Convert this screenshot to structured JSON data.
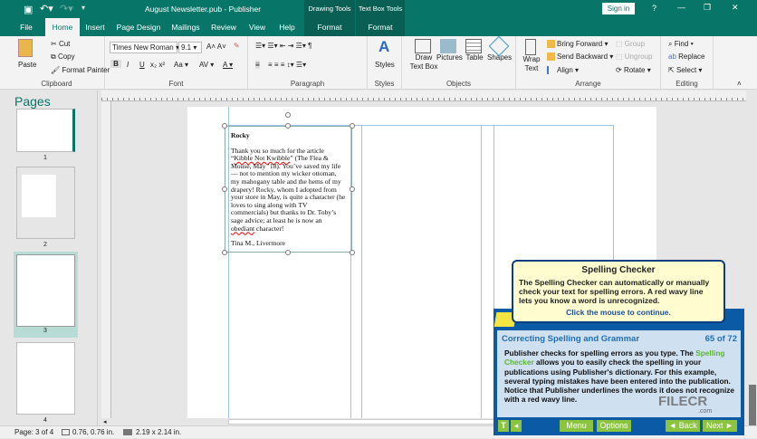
{
  "title": {
    "doc": "August Newsletter.pub  -  Publisher",
    "drawing_tools": "Drawing Tools",
    "text_box_tools": "Text Box Tools",
    "sign_in": "Sign in",
    "help": "?"
  },
  "tabs": [
    "File",
    "Home",
    "Insert",
    "Page Design",
    "Mailings",
    "Review",
    "View",
    "Help",
    "Format",
    "Format"
  ],
  "ribbon": {
    "clipboard": {
      "paste": "Paste",
      "cut": "Cut",
      "copy": "Copy",
      "format_painter": "Format Painter",
      "label": "Clipboard"
    },
    "font": {
      "name": "Times New Roman",
      "size": "9.1",
      "label": "Font",
      "bold": "B",
      "italic": "I",
      "underline": "U",
      "aa": "Aa"
    },
    "paragraph": {
      "label": "Paragraph"
    },
    "styles": {
      "styles": "Styles",
      "label": "Styles"
    },
    "objects": {
      "draw_text_box": "Draw Text Box",
      "pictures": "Pictures",
      "table": "Table",
      "shapes": "Shapes",
      "label": "Objects"
    },
    "arrange": {
      "wrap_text": "Wrap Text",
      "bring_forward": "Bring Forward",
      "send_backward": "Send Backward",
      "align": "Align",
      "group": "Group",
      "ungroup": "Ungroup",
      "rotate": "Rotate",
      "label": "Arrange"
    },
    "editing": {
      "find": "Find",
      "replace": "Replace",
      "select": "Select",
      "label": "Editing"
    }
  },
  "pages_pane": {
    "title": "Pages",
    "pages": [
      "1",
      "2",
      "3",
      "4"
    ],
    "selected": "3"
  },
  "textbox": {
    "heading": "Rocky",
    "p1a": "Thank you so much for  the article “",
    "p1w": "Kibble Not Kwibble",
    "p1b": "” (The Flea & Mouse, May ’18). You’ve saved my life — not to mention my wicker ottoman, my mahogany table and the hems of my drapery! Rocky, whom I adopted from your store in May, is quite a character (he loves to sing along with TV commercials) but thanks to Dr. Toby’s sage advice; at least he is now an ",
    "p1w2": "obediant",
    "p1c": " character!",
    "signature": "Tina M., Livermore"
  },
  "status": {
    "page": "Page: 3 of 4",
    "position": "0.76, 0.76 in.",
    "size": "2.19 x 2.14 in."
  },
  "tooltip": {
    "title": "Spelling Checker",
    "body": "The Spelling Checker can automatically or manually check your text for spelling errors. A red wavy line lets you know a word is unrecognized.",
    "action": "Click the mouse to continue."
  },
  "tutorial": {
    "heading": "Correcting Spelling and Grammar",
    "progress": "65 of 72",
    "body_a": "Publisher checks for spelling errors as you type. The ",
    "body_link": "Spelling Checker",
    "body_b": " allows you to easily check the spelling in your publications using Publisher's dictionary. For this example, several typing mistakes have been entered into the publication. Notice that Publisher underlines the words it does not recognize with a red wavy line.",
    "t": "T",
    "menu": "Menu",
    "options": "Options",
    "back": "◄ Back",
    "next": "Next ►",
    "watermark": "FILECR",
    "watermark_sub": ".com"
  }
}
